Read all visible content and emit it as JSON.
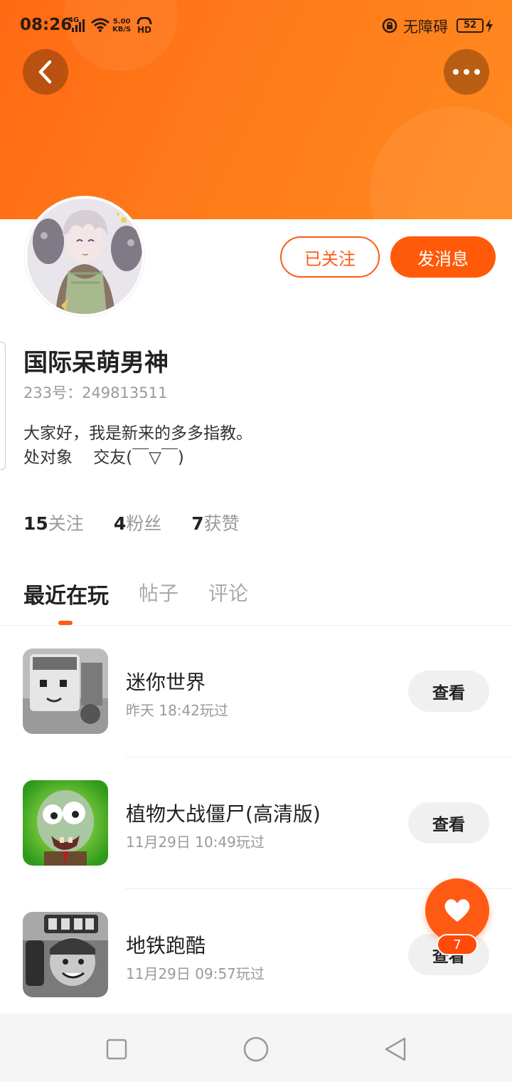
{
  "status": {
    "time": "08:26",
    "network": "4G",
    "speed_value": "5.00",
    "speed_unit": "KB/S",
    "hd": "HD",
    "accessibility": "无障碍",
    "battery": "52"
  },
  "header": {
    "back_icon": "chevron-left-icon",
    "more_icon": "more-horizontal-icon",
    "accent_color": "#ff6a13"
  },
  "actions": {
    "followed_label": "已关注",
    "message_label": "发消息"
  },
  "profile": {
    "name": "国际呆萌男神",
    "id_line": "233号：249813511",
    "bio_line1": "大家好，我是新来的多多指教。",
    "bio_line2": "处对象    交友(￣▽￣)"
  },
  "stats": {
    "following_count": "15",
    "following_label": "关注",
    "followers_count": "4",
    "followers_label": "粉丝",
    "likes_count": "7",
    "likes_label": "获赞"
  },
  "tabs": [
    {
      "label": "最近在玩",
      "active": true
    },
    {
      "label": "帖子",
      "active": false
    },
    {
      "label": "评论",
      "active": false
    }
  ],
  "games": [
    {
      "title": "迷你世界",
      "played": "昨天 18:42玩过",
      "button": "查看"
    },
    {
      "title": "植物大战僵尸(高清版)",
      "played": "11月29日 10:49玩过",
      "button": "查看"
    },
    {
      "title": "地铁跑酷",
      "played": "11月29日 09:57玩过",
      "button": "查看"
    }
  ],
  "fab": {
    "icon": "heart-icon",
    "badge": "7"
  },
  "navbar": {
    "recent_icon": "square-icon",
    "home_icon": "circle-icon",
    "back_icon": "triangle-back-icon"
  }
}
